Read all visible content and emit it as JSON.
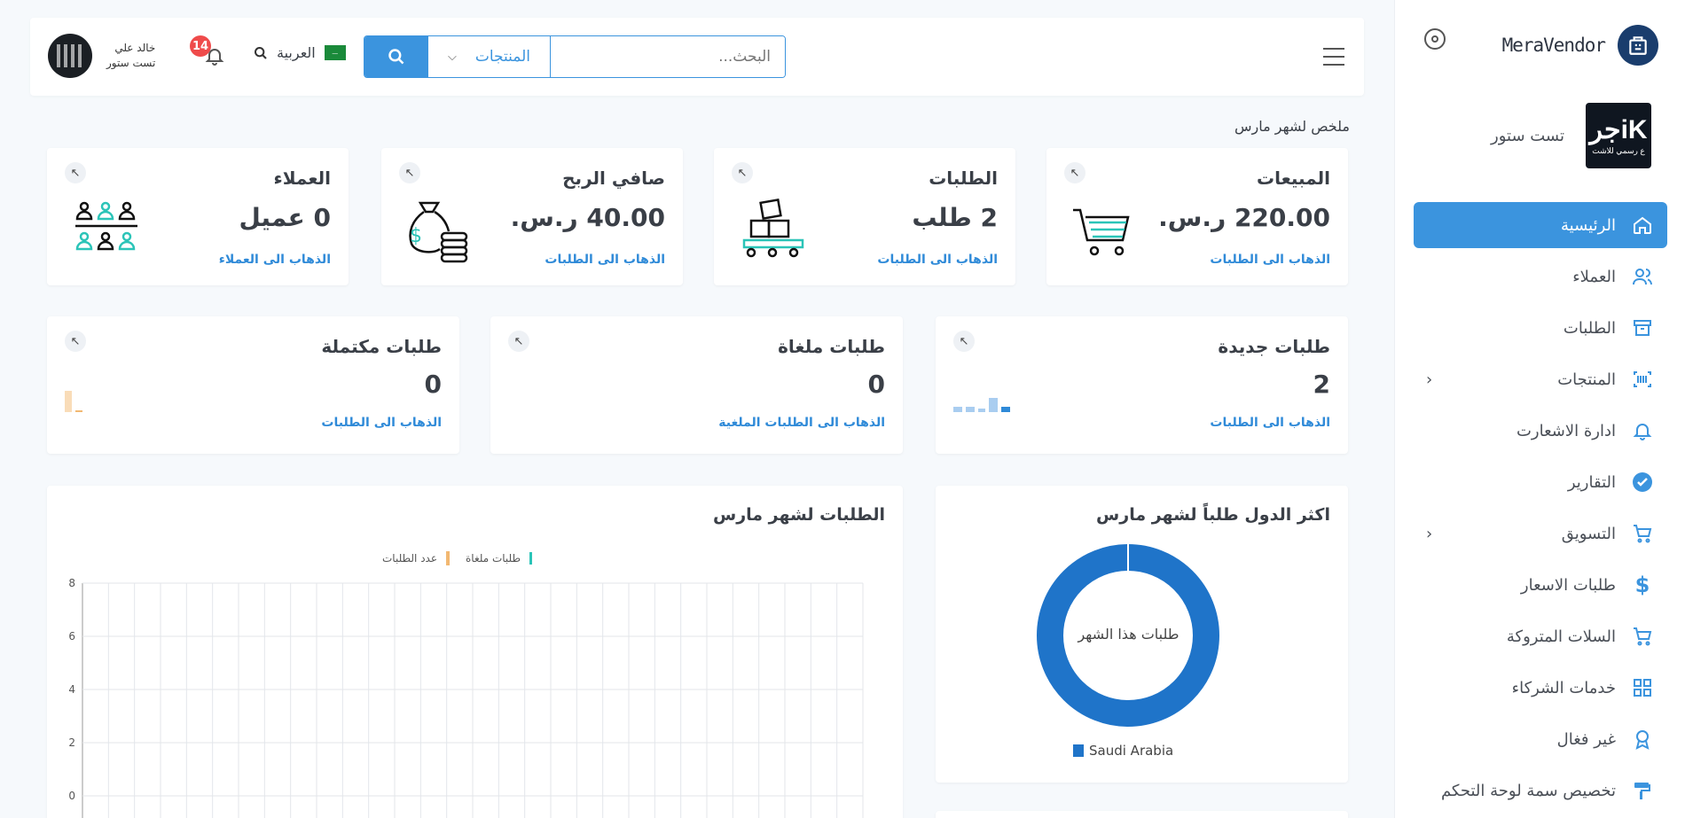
{
  "sidebar": {
    "brand_name": "MeraVendor",
    "store_name": "تست ستور",
    "store_logo_text": "iKجر",
    "store_logo_sub": "ع رسمي للاشت",
    "items": [
      {
        "label": "الرئيسية",
        "icon": "home-icon",
        "active": true
      },
      {
        "label": "العملاء",
        "icon": "users-icon"
      },
      {
        "label": "الطلبات",
        "icon": "archive-icon"
      },
      {
        "label": "المنتجات",
        "icon": "barcode-icon",
        "has_children": true
      },
      {
        "label": "ادارة الاشعارت",
        "icon": "bell-icon"
      },
      {
        "label": "التقارير",
        "icon": "check-circle-icon"
      },
      {
        "label": "التسويق",
        "icon": "cart-icon",
        "has_children": true
      },
      {
        "label": "طلبات الاسعار",
        "icon": "dollar-icon"
      },
      {
        "label": "السلات المتروكة",
        "icon": "cart-icon"
      },
      {
        "label": "خدمات الشركاء",
        "icon": "grid-icon"
      },
      {
        "label": "غير فغال",
        "icon": "award-icon"
      },
      {
        "label": "تخصيص سمة لوحة التحكم",
        "icon": "paint-roller-icon"
      }
    ]
  },
  "topbar": {
    "search_placeholder": "البحث...",
    "search_scope": "المنتجات",
    "language": "العربية",
    "notification_count": "14",
    "user_name": "خالد علي",
    "user_role": "تست ستور"
  },
  "summary": {
    "title": "ملخص لشهر مارس",
    "cards": [
      {
        "title": "المبيعات",
        "value": "220.00 ر.س.",
        "link": "الذهاب الى الطلبات"
      },
      {
        "title": "الطلبات",
        "value": "2 طلب",
        "link": "الذهاب الى الطلبات"
      },
      {
        "title": "صافي الربح",
        "value": "40.00 ر.س.",
        "link": "الذهاب الى الطلبات"
      },
      {
        "title": "العملاء",
        "value": "0 عميل",
        "link": "الذهاب الى العملاء"
      }
    ],
    "orders": [
      {
        "title": "طلبات جديدة",
        "value": "2",
        "link": "الذهاب الى الطلبات"
      },
      {
        "title": "طلبات ملغاة",
        "value": "0",
        "link": "الذهاب الى الطلبات الملغية"
      },
      {
        "title": "طلبات مكتملة",
        "value": "0",
        "link": "الذهاب الى الطلبات"
      }
    ]
  },
  "countries_panel": {
    "title": "اكثر الدول طلباً لشهر مارس",
    "center_label": "طلبات هذا الشهر",
    "legend": "Saudi Arabia"
  },
  "orders_chart_panel": {
    "title": "الطلبات لشهر مارس",
    "legend_orders": "عدد الطلبات",
    "legend_cancelled": "طلبات ملغاة"
  },
  "colors": {
    "accent": "#3b94de",
    "donut": "#1f74c9",
    "orders_series": "#f2b872",
    "cancelled_series": "#2bc4b8"
  },
  "chart_data": [
    {
      "type": "pie",
      "title": "اكثر الدول طلباً لشهر مارس",
      "categories": [
        "Saudi Arabia"
      ],
      "values": [
        100
      ]
    },
    {
      "type": "line",
      "title": "الطلبات لشهر مارس",
      "series": [
        {
          "name": "عدد الطلبات",
          "values": []
        },
        {
          "name": "طلبات ملغاة",
          "values": []
        }
      ],
      "y_ticks": [
        "0",
        "2",
        "4",
        "6",
        "8"
      ],
      "grid": true
    }
  ]
}
